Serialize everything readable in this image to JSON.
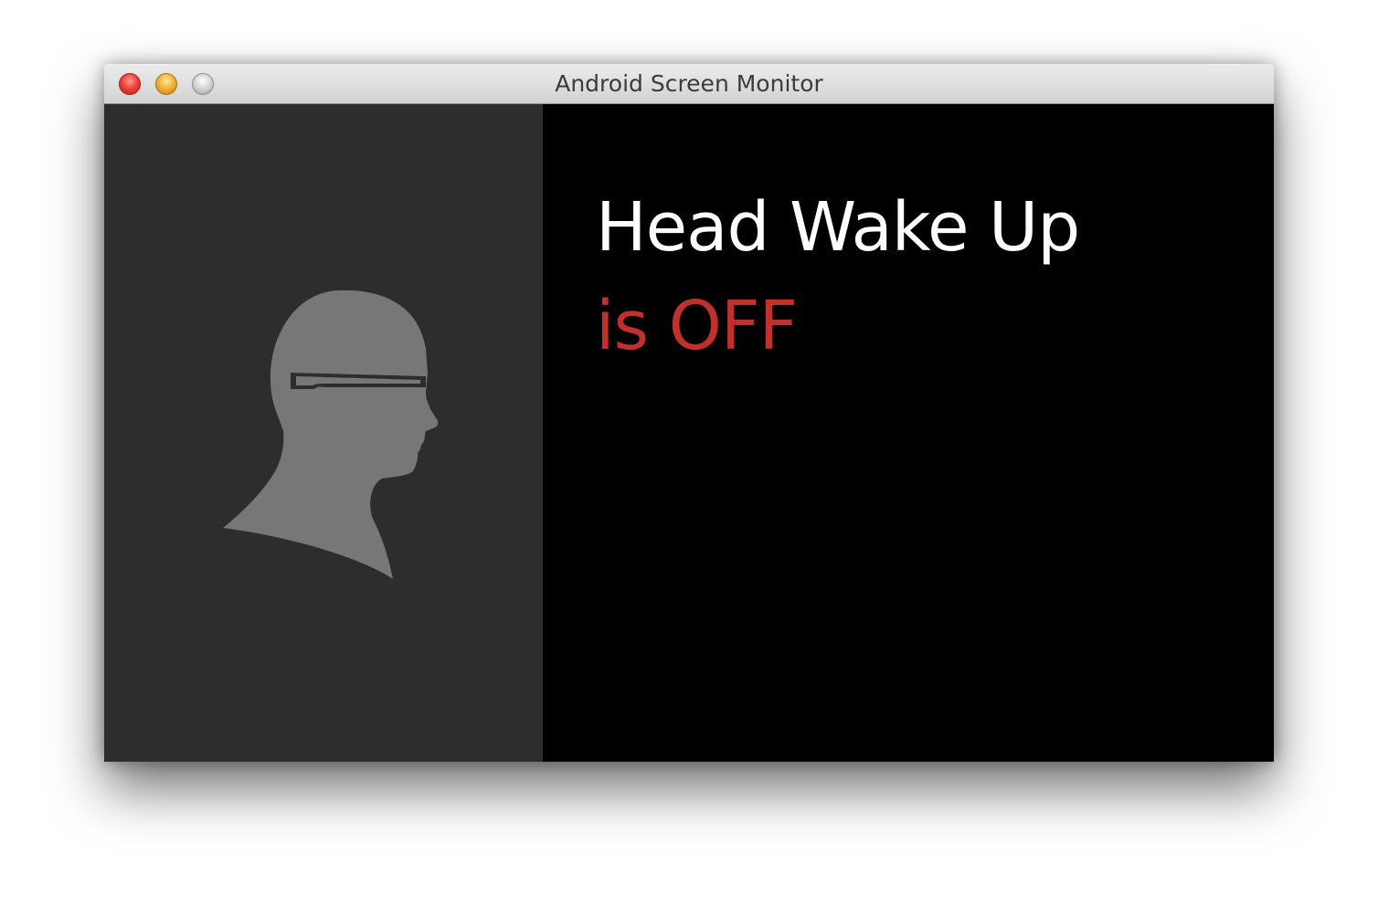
{
  "window": {
    "title": "Android Screen Monitor"
  },
  "screen": {
    "heading": "Head Wake Up",
    "status": "is OFF",
    "status_color": "#c1302d",
    "left_panel_color": "#2d2d2d",
    "illustration_color": "#777777",
    "illustration_icon": "head-with-glass-icon"
  }
}
